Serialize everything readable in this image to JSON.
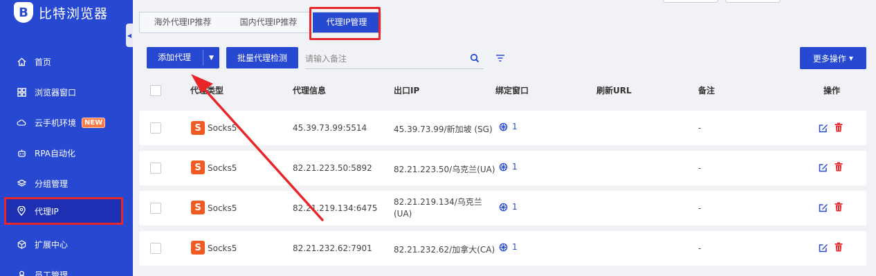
{
  "app": {
    "name": "比特浏览器",
    "logo_letter": "B"
  },
  "sidebar": {
    "items": [
      {
        "label": "首页",
        "icon": "home-icon"
      },
      {
        "label": "浏览器窗口",
        "icon": "grid-icon"
      },
      {
        "label": "云手机环境",
        "icon": "cloud-icon",
        "badge": "NEW"
      },
      {
        "label": "RPA自动化",
        "icon": "robot-icon"
      },
      {
        "label": "分组管理",
        "icon": "layers-icon"
      },
      {
        "label": "代理IP",
        "icon": "location-pin-icon",
        "active": true
      },
      {
        "label": "扩展中心",
        "icon": "cube-icon"
      },
      {
        "label": "员工管理",
        "icon": "user-icon"
      }
    ]
  },
  "tabs": [
    {
      "label": "海外代理IP推荐"
    },
    {
      "label": "国内代理IP推荐"
    },
    {
      "label": "代理IP管理",
      "active": true
    }
  ],
  "toolbar": {
    "add_proxy": "添加代理",
    "batch_check": "批量代理检测",
    "search_placeholder": "请输入备注",
    "more_actions": "更多操作"
  },
  "table": {
    "columns": [
      "代理类型",
      "代理信息",
      "出口IP",
      "绑定窗口",
      "刷新URL",
      "备注",
      "操作"
    ],
    "rows": [
      {
        "type": "Socks5",
        "info": "45.39.73.99:5514",
        "exit_ip": "45.39.73.99/新加坡 (SG)",
        "windows": "1",
        "note": "-"
      },
      {
        "type": "Socks5",
        "info": "82.21.223.50:5892",
        "exit_ip": "82.21.223.50/乌克兰(UA)",
        "windows": "1",
        "note": "-"
      },
      {
        "type": "Socks5",
        "info": "82.21.219.134:6475",
        "exit_ip_line1": "82.21.219.134/乌克兰",
        "exit_ip_line2": "(UA)",
        "windows": "1",
        "note": "-"
      },
      {
        "type": "Socks5",
        "info": "82.21.232.62:7901",
        "exit_ip": "82.21.232.62/加拿大(CA)",
        "windows": "1",
        "note": "-"
      }
    ],
    "type_icon_letter": "S"
  },
  "colors": {
    "primary": "#2748d0",
    "highlight": "#e8262a",
    "socks": "#f05b24",
    "delete": "#e8262a"
  }
}
